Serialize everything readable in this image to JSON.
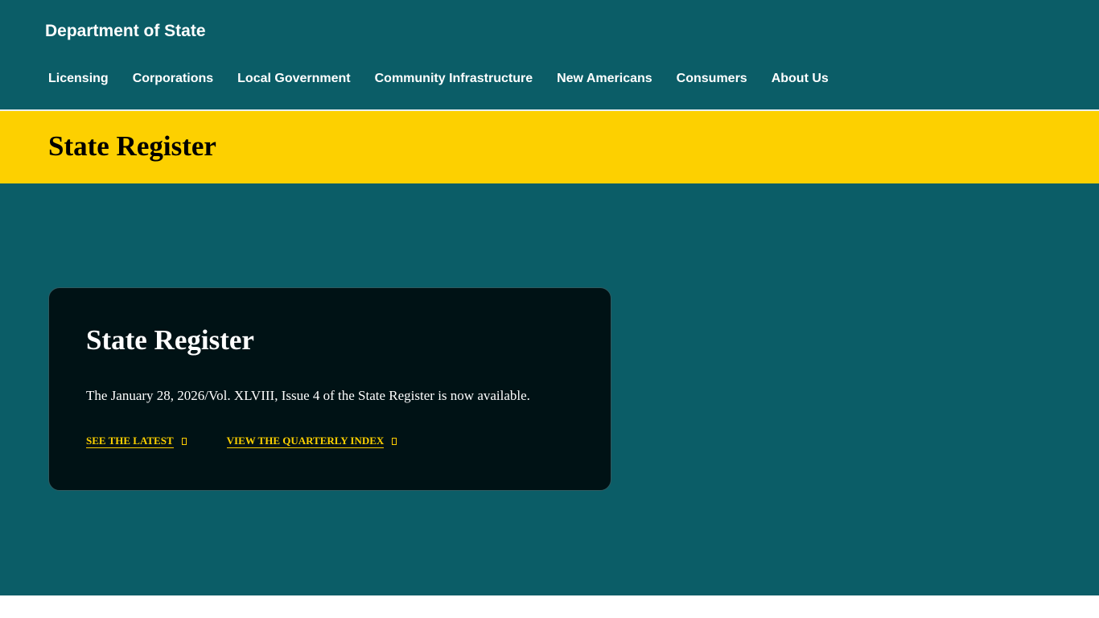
{
  "header": {
    "site_title": "Department of State",
    "nav": [
      {
        "label": "Licensing"
      },
      {
        "label": "Corporations"
      },
      {
        "label": "Local Government"
      },
      {
        "label": "Community Infrastructure"
      },
      {
        "label": "New Americans"
      },
      {
        "label": "Consumers"
      },
      {
        "label": "About Us"
      }
    ]
  },
  "page": {
    "title": "State Register"
  },
  "card": {
    "title": "State Register",
    "text": "The January 28, 2026/Vol. XLVIII, Issue 4 of the State Register is now available.",
    "links": [
      {
        "label": "SEE THE LATEST",
        "icon": "external-link-icon"
      },
      {
        "label": "VIEW THE QUARTERLY INDEX",
        "icon": "external-link-icon"
      }
    ]
  },
  "colors": {
    "teal": "#0b5d67",
    "yellow": "#fdd000",
    "card_bg": "#001215"
  }
}
